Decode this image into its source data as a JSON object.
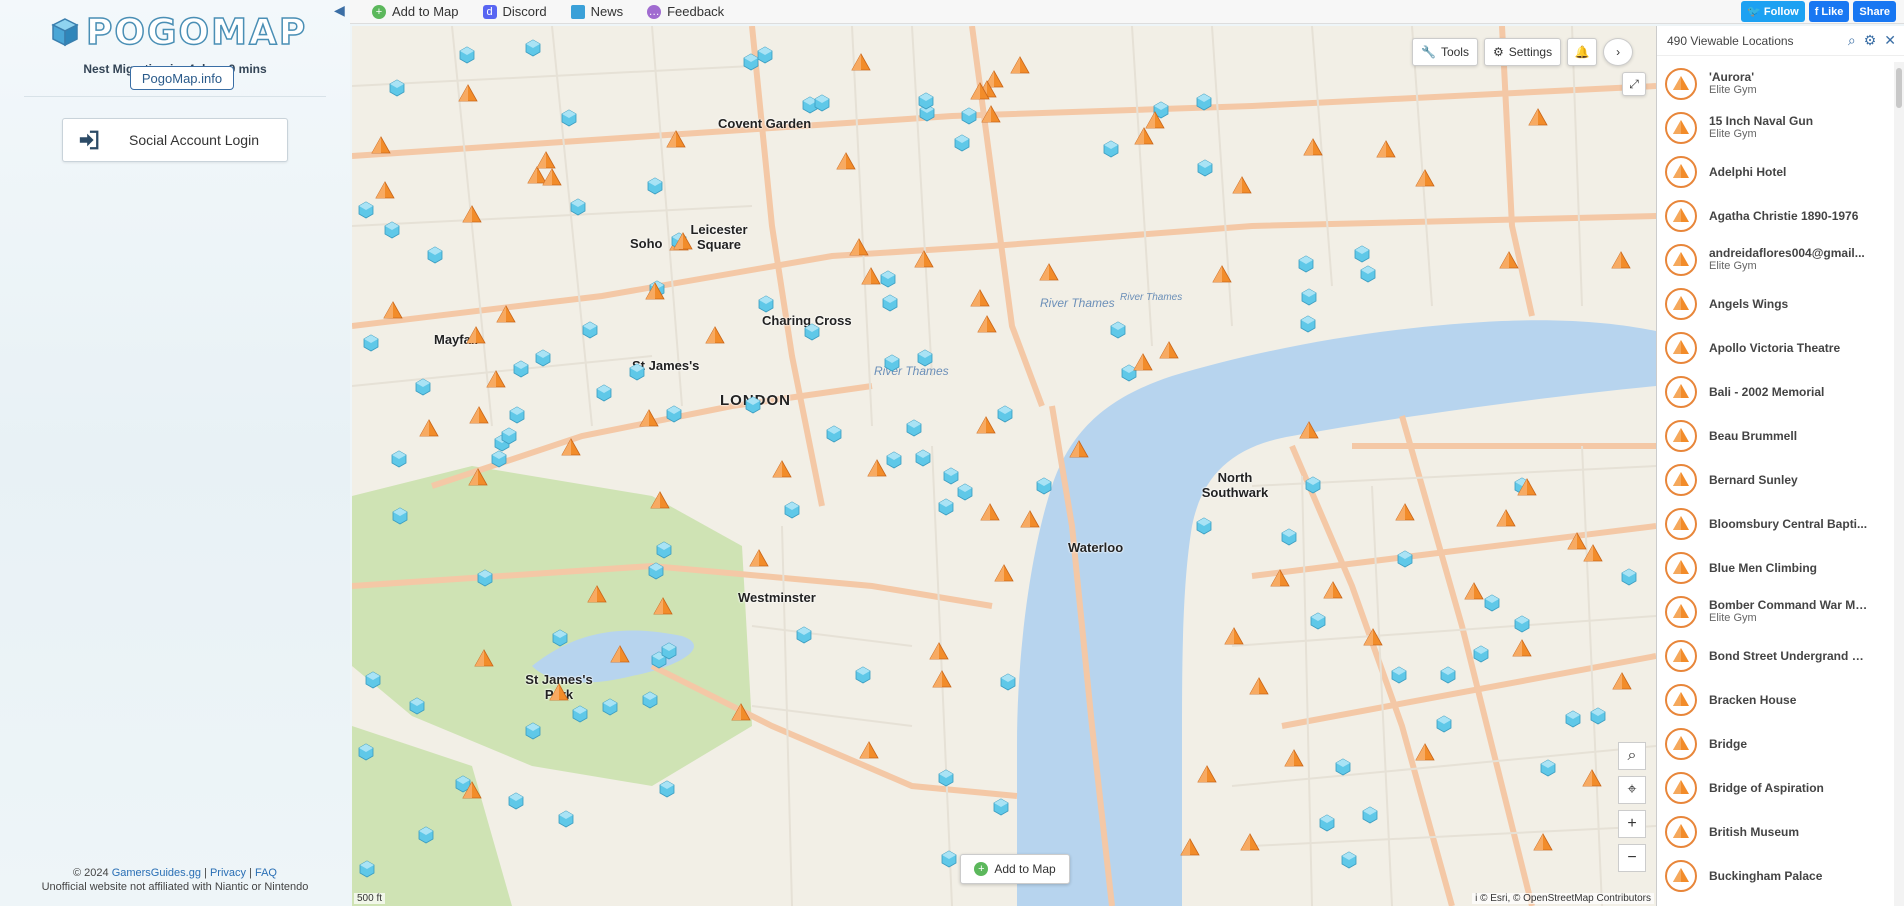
{
  "left_panel": {
    "logo_text": "POGOMAP",
    "nest_migration": "Nest Migration in: 4 days 9 mins",
    "pogomap_info_label": "PogoMap.info",
    "login_label": "Social Account Login",
    "footer": {
      "copyright": "© 2024",
      "gamers_guides": "GamersGuides.gg",
      "privacy": "Privacy",
      "faq": "FAQ",
      "disclaimer": "Unofficial website not affiliated with Niantic or Nintendo"
    }
  },
  "topbar": {
    "items": [
      {
        "label": "Add to Map",
        "icon": "plus-circle-icon",
        "color": "#5cb85c"
      },
      {
        "label": "Discord",
        "icon": "discord-icon",
        "color": "#5865f2"
      },
      {
        "label": "News",
        "icon": "cube-icon",
        "color": "#3aa0d8"
      },
      {
        "label": "Feedback",
        "icon": "speech-bubble-icon",
        "color": "#a06bd0"
      }
    ],
    "social": [
      {
        "label": "Follow",
        "icon": "twitter-icon",
        "color": "#1da1f2"
      },
      {
        "label": "Like",
        "icon": "facebook-icon",
        "color": "#1877f2"
      },
      {
        "label": "Share",
        "icon": "facebook-icon",
        "color": "#1877f2"
      }
    ]
  },
  "map": {
    "tools_label": "Tools",
    "settings_label": "Settings",
    "add_to_map_label": "Add to Map",
    "scale_label": "500 ft",
    "attribution": "i © Esri, © OpenStreetMap Contributors",
    "areas": [
      "Covent Garden",
      "Soho",
      "Leicester Square",
      "Mayfair",
      "St James's",
      "Charing Cross",
      "LONDON",
      "Westminster",
      "Waterloo",
      "North Southwark",
      "St James's Park"
    ],
    "water": [
      "River Thames",
      "River Thames",
      "River Thames"
    ],
    "colors": {
      "gym": "#f28c2a",
      "pokestop": "#5fc8e8",
      "land": "#f2efe6",
      "park": "#cfe3b4",
      "water": "#b7d4ee",
      "road": "#f4c8a6"
    }
  },
  "right_panel": {
    "count": "490 Viewable Locations",
    "locations": [
      {
        "name": "'Aurora'",
        "sub": "Elite Gym"
      },
      {
        "name": "15 Inch Naval Gun",
        "sub": "Elite Gym"
      },
      {
        "name": "Adelphi Hotel",
        "sub": ""
      },
      {
        "name": "Agatha Christie 1890-1976",
        "sub": ""
      },
      {
        "name": "andreidaflores004@gmail...",
        "sub": "Elite Gym"
      },
      {
        "name": "Angels Wings",
        "sub": ""
      },
      {
        "name": "Apollo Victoria Theatre",
        "sub": ""
      },
      {
        "name": "Bali - 2002 Memorial",
        "sub": ""
      },
      {
        "name": "Beau Brummell",
        "sub": ""
      },
      {
        "name": "Bernard Sunley",
        "sub": ""
      },
      {
        "name": "Bloomsbury Central Bapti...",
        "sub": ""
      },
      {
        "name": "Blue Men Climbing",
        "sub": ""
      },
      {
        "name": "Bomber Command War Memor...",
        "sub": "Elite Gym"
      },
      {
        "name": "Bond Street Undergrand S...",
        "sub": ""
      },
      {
        "name": "Bracken House",
        "sub": ""
      },
      {
        "name": "Bridge",
        "sub": ""
      },
      {
        "name": "Bridge of Aspiration",
        "sub": ""
      },
      {
        "name": "British Museum",
        "sub": ""
      },
      {
        "name": "Buckingham Palace",
        "sub": ""
      }
    ]
  }
}
